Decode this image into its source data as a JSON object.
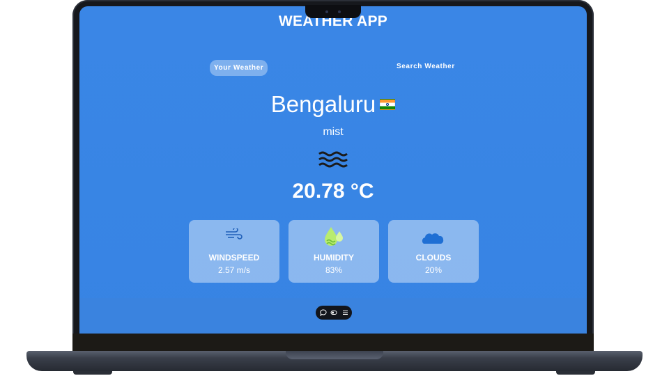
{
  "app": {
    "title": "WEATHER APP"
  },
  "tabs": [
    {
      "label": "Your Weather",
      "active": true
    },
    {
      "label": "Search Weather",
      "active": false
    }
  ],
  "weather": {
    "city": "Bengaluru",
    "country_flag": "india-flag-icon",
    "condition": "mist",
    "condition_icon": "mist-icon",
    "temperature": "20.78 °C"
  },
  "stats": [
    {
      "label": "WINDSPEED",
      "value": "2.57 m/s",
      "icon": "wind-icon"
    },
    {
      "label": "HUMIDITY",
      "value": "83%",
      "icon": "humidity-icon"
    },
    {
      "label": "CLOUDS",
      "value": "20%",
      "icon": "cloud-icon"
    }
  ],
  "dock": {
    "icons": [
      "chat-icon",
      "toggle-icon",
      "menu-icon"
    ]
  },
  "colors": {
    "background": "#3a86e6",
    "card": "rgba(255,255,255,0.42)",
    "text": "#ffffff"
  }
}
